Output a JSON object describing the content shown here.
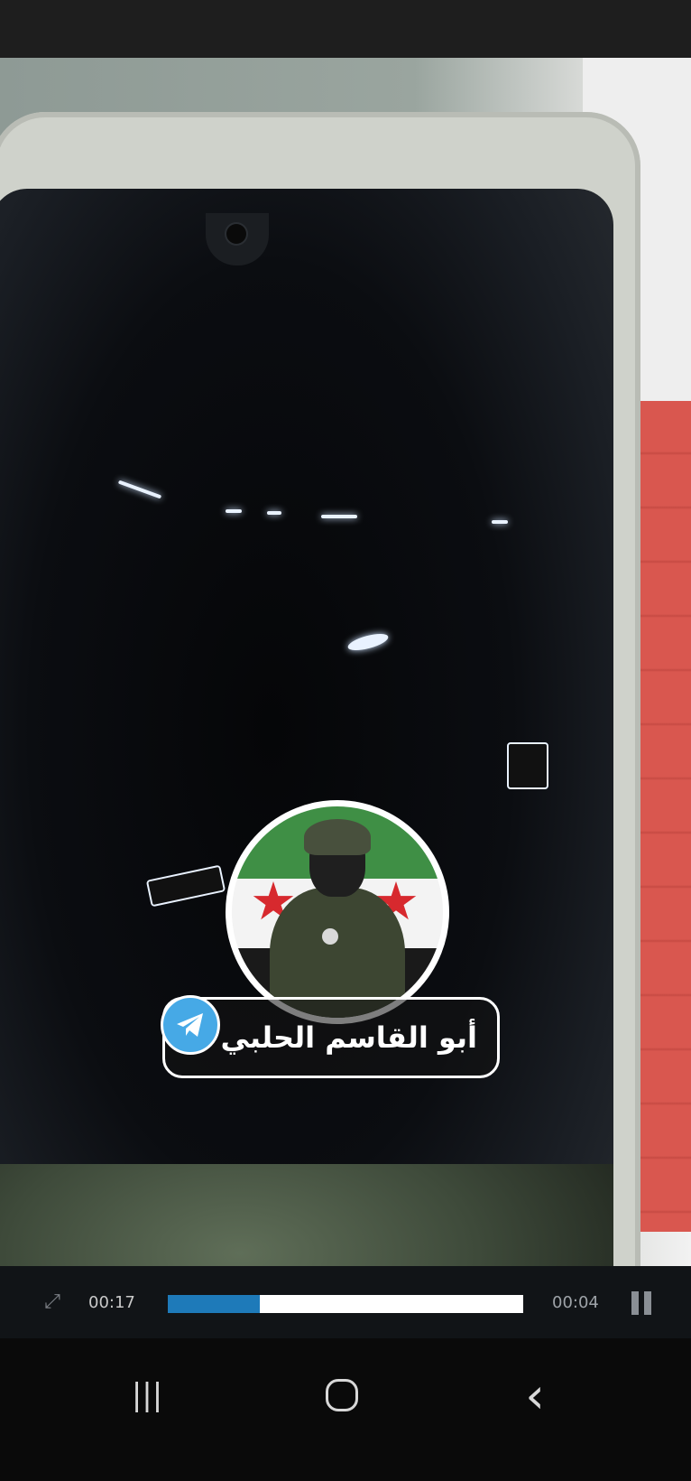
{
  "player": {
    "elapsed": "00:17",
    "remaining": "00:04",
    "progress_fraction": 0.26,
    "accent": "#1e7ab9"
  },
  "overlay": {
    "channel_name": "أبو القاسم الحلبي",
    "telegram_color": "#46a9e6"
  },
  "icons": {
    "expand": "expand-icon",
    "pause": "pause-icon",
    "telegram": "telegram-icon",
    "recents": "recents-icon",
    "home": "home-icon",
    "back": "back-icon"
  },
  "navbar": {
    "recents_glyph": "|||",
    "back_glyph": "‹"
  }
}
